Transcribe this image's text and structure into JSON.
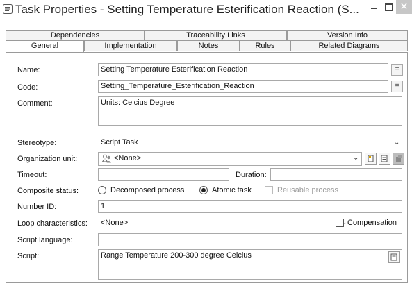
{
  "window": {
    "title": "Task Properties - Setting Temperature Esterification Reaction (S...",
    "minimize": "–",
    "close": "✕"
  },
  "tabs": {
    "row1": [
      "Dependencies",
      "Traceability Links",
      "Version Info"
    ],
    "row2": [
      "General",
      "Implementation",
      "Notes",
      "Rules",
      "Related Diagrams"
    ],
    "active": "General"
  },
  "form": {
    "name_label": "Name:",
    "name_value": "Setting Temperature Esterification Reaction",
    "code_label": "Code:",
    "code_value": "Setting_Temperature_Esterification_Reaction",
    "comment_label": "Comment:",
    "comment_value": "Units: Celcius Degree",
    "stereotype_label": "Stereotype:",
    "stereotype_value": "Script Task",
    "org_unit_label": "Organization unit:",
    "org_unit_value": "<None>",
    "timeout_label": "Timeout:",
    "timeout_value": "",
    "duration_label": "Duration:",
    "duration_value": "",
    "composite_label": "Composite status:",
    "composite_options": [
      "Decomposed process",
      "Atomic task",
      "Reusable process"
    ],
    "composite_selected": "Atomic task",
    "number_label": "Number ID:",
    "number_value": "1",
    "loop_label": "Loop characteristics:",
    "loop_value": "<None>",
    "compensation_label": "Compensation",
    "script_lang_label": "Script language:",
    "script_lang_value": "",
    "script_label": "Script:",
    "script_value": "Range Temperature 200-300 degree Celcius",
    "ellipsis": "="
  }
}
